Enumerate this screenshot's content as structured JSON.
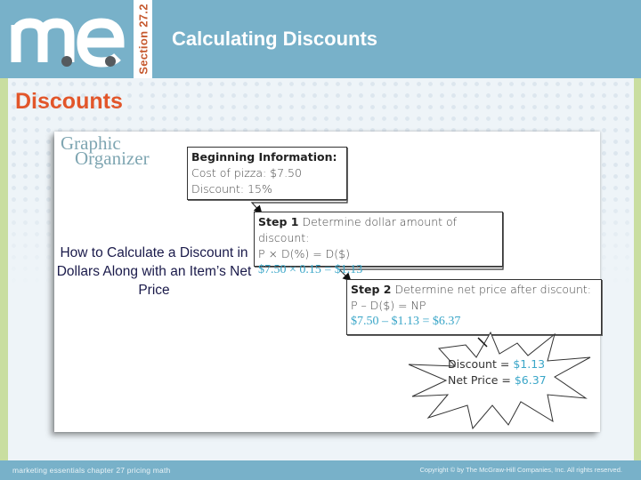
{
  "header": {
    "logo_text": "me",
    "section_label": "Section 27.2",
    "title": "Calculating Discounts"
  },
  "slide": {
    "title": "Discounts",
    "caption": "How to Calculate a Discount in Dollars Along with an Item’s Net Price"
  },
  "figure": {
    "organizer_title_line1": "Graphic",
    "organizer_title_line2": "Organizer",
    "beginning": {
      "heading": "Beginning Information:",
      "line1": "Cost of pizza: $7.50",
      "line2": "Discount: 15%"
    },
    "step1": {
      "label": "Step 1",
      "text": "Determine dollar amount of discount:",
      "formula": "P × D(%) = D($)",
      "calculation": "$7.50 × 0.15 = $1.13"
    },
    "step2": {
      "label": "Step 2",
      "text": "Determine net price after discount:",
      "formula": "P – D($) = NP",
      "calculation": "$7.50 – $1.13 = $6.37"
    },
    "result": {
      "discount_label": "Discount =",
      "discount_value": "$1.13",
      "net_price_label": "Net Price =",
      "net_price_value": "$6.37"
    }
  },
  "footer": {
    "left": "marketing essentials  chapter 27  pricing math",
    "right": "Copyright © by The McGraw-Hill Companies, Inc. All rights reserved."
  },
  "colors": {
    "header_blue": "#78b1c9",
    "title_orange": "#e2562a",
    "section_orange": "#c65a30",
    "accent_green": "#c9dea0",
    "calc_blue": "#3aa6c8"
  }
}
